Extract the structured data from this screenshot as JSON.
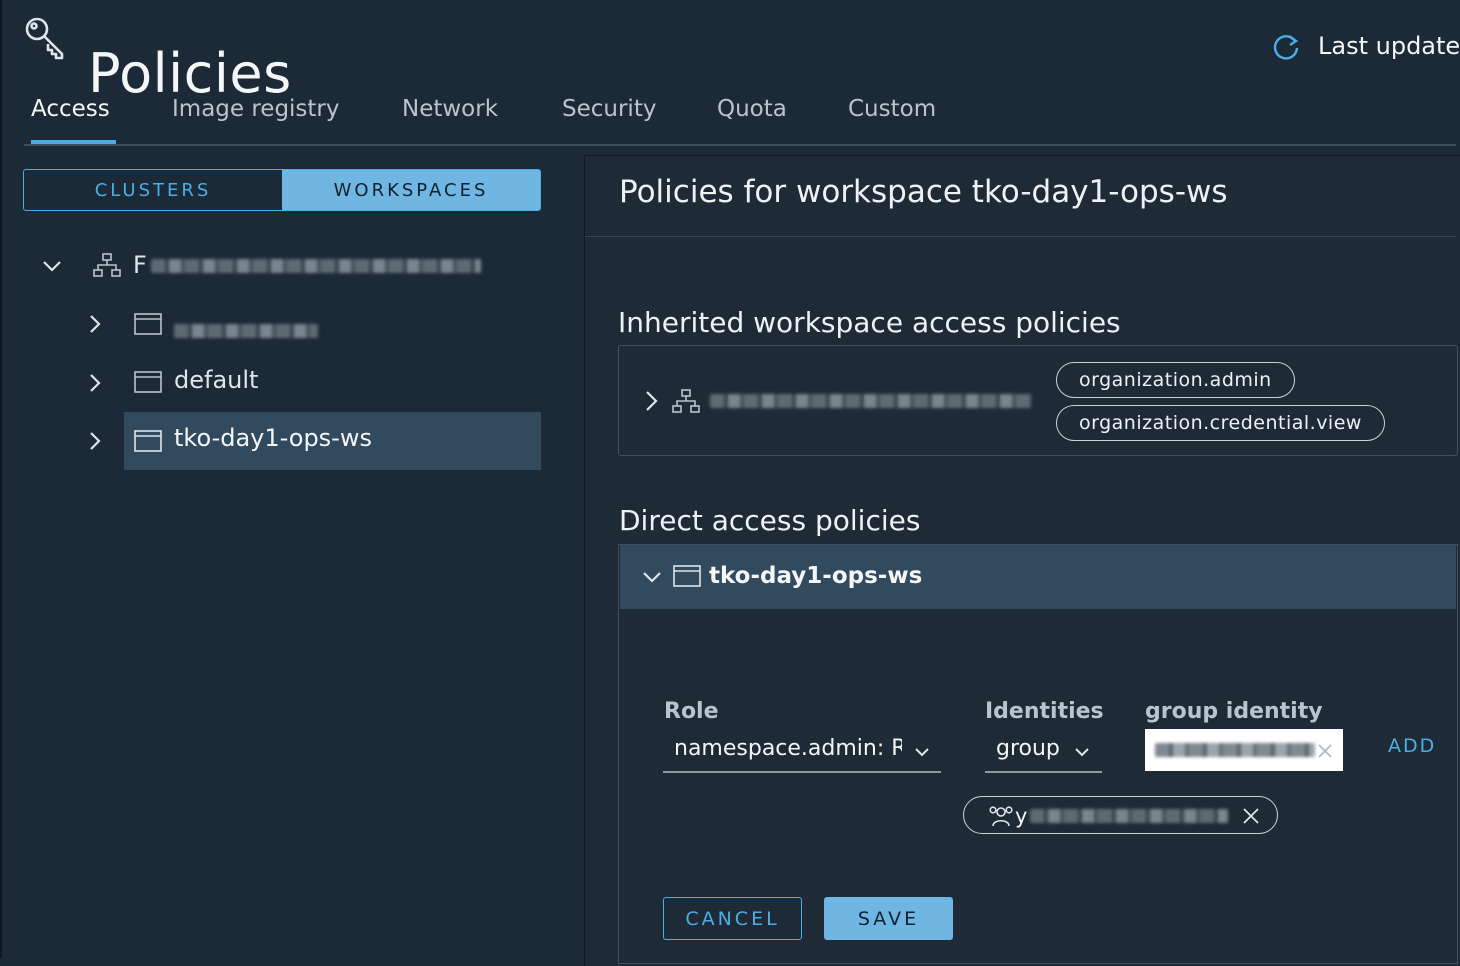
{
  "header": {
    "title": "Policies",
    "last_update": "Last update"
  },
  "tabs": [
    {
      "label": "Access",
      "active": true
    },
    {
      "label": "Image registry"
    },
    {
      "label": "Network"
    },
    {
      "label": "Security"
    },
    {
      "label": "Quota"
    },
    {
      "label": "Custom"
    }
  ],
  "segmented": {
    "clusters": "CLUSTERS",
    "workspaces": "WORKSPACES",
    "selected": "WORKSPACES"
  },
  "tree": {
    "org_prefix": "F",
    "items": [
      {
        "label": "default"
      },
      {
        "label": "tko-day1-ops-ws",
        "selected": true
      }
    ]
  },
  "panel": {
    "title": "Policies for workspace tko-day1-ops-ws",
    "inherited_title": "Inherited workspace access policies",
    "inherited_roles": [
      "organization.admin",
      "organization.credential.view"
    ],
    "direct_title": "Direct access policies",
    "direct_workspace": "tko-day1-ops-ws"
  },
  "form": {
    "role_label": "Role",
    "role_value": "namespace.admin: R",
    "identities_label": "Identities",
    "identities_value": "group",
    "group_identity_label": "group identity",
    "add": "ADD",
    "identity_chip_prefix": "y",
    "cancel": "CANCEL",
    "save": "SAVE"
  },
  "colors": {
    "background": "#1b2a36",
    "accent": "#4aaee6",
    "selected_row": "#324a5e",
    "primary_button": "#6fb6e3"
  },
  "icons": [
    "key-icon",
    "refresh-icon",
    "org-icon",
    "workspace-icon",
    "chevron-icon",
    "group-icon",
    "close-icon"
  ]
}
